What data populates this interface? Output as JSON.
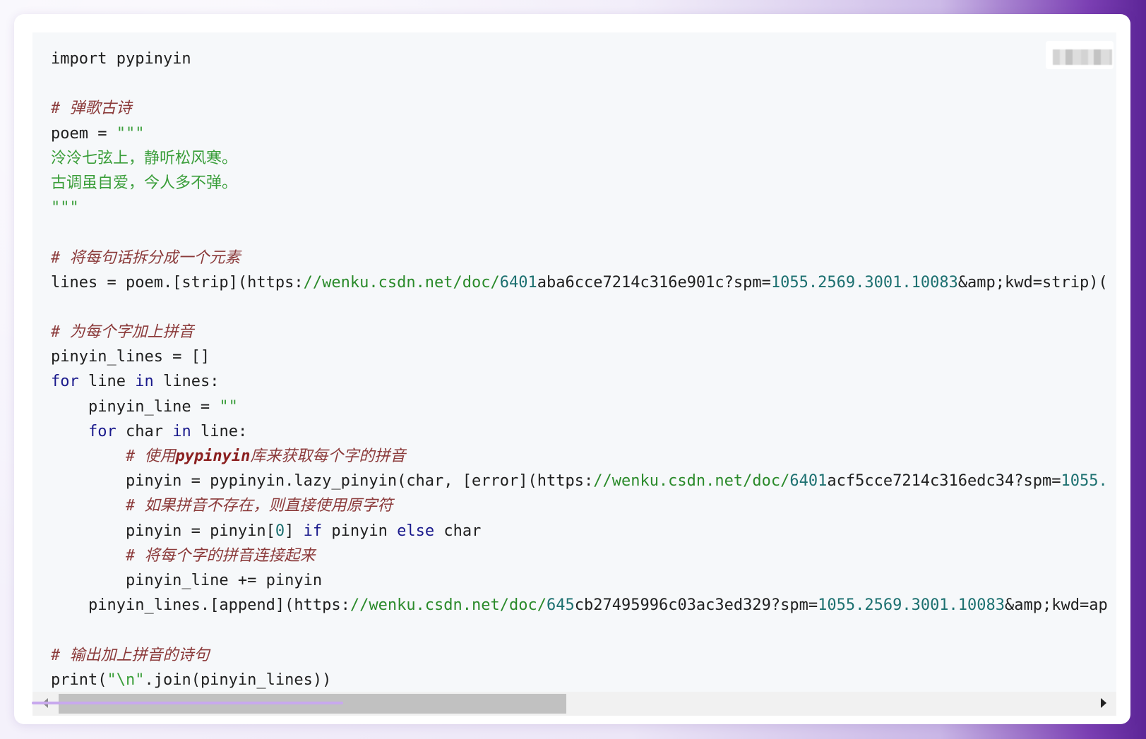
{
  "code": {
    "lines": [
      [
        {
          "t": "import pypinyin",
          "c": ""
        }
      ],
      [],
      [
        {
          "t": "# 弹歌古诗",
          "c": "cmt"
        }
      ],
      [
        {
          "t": "poem = ",
          "c": ""
        },
        {
          "t": "\"\"\"",
          "c": "str"
        }
      ],
      [
        {
          "t": "泠泠七弦上，静听松风寒。",
          "c": "str-cjk"
        }
      ],
      [
        {
          "t": "古调虽自爱，今人多不弹。",
          "c": "str-cjk"
        }
      ],
      [
        {
          "t": "\"\"\"",
          "c": "str"
        }
      ],
      [],
      [
        {
          "t": "# 将每句话拆分成一个元素",
          "c": "cmt"
        }
      ],
      [
        {
          "t": "lines = poem.[strip](https:",
          "c": ""
        },
        {
          "t": "//wenku.csdn.net",
          "c": "path"
        },
        {
          "t": "/doc/",
          "c": "path"
        },
        {
          "t": "6401",
          "c": "num"
        },
        {
          "t": "aba6cce7214c316e901c?spm=",
          "c": ""
        },
        {
          "t": "1055.2569.3001.10083",
          "c": "num"
        },
        {
          "t": "&amp;kwd=strip)(",
          "c": ""
        }
      ],
      [],
      [
        {
          "t": "# 为每个字加上拼音",
          "c": "cmt"
        }
      ],
      [
        {
          "t": "pinyin_lines = []",
          "c": ""
        }
      ],
      [
        {
          "t": "for",
          "c": "kw"
        },
        {
          "t": " line ",
          "c": ""
        },
        {
          "t": "in",
          "c": "kw"
        },
        {
          "t": " lines:",
          "c": ""
        }
      ],
      [
        {
          "t": "    pinyin_line = ",
          "c": ""
        },
        {
          "t": "\"\"",
          "c": "str"
        }
      ],
      [
        {
          "t": "    ",
          "c": ""
        },
        {
          "t": "for",
          "c": "kw"
        },
        {
          "t": " char ",
          "c": ""
        },
        {
          "t": "in",
          "c": "kw"
        },
        {
          "t": " line:",
          "c": ""
        }
      ],
      [
        {
          "t": "        # 使用",
          "c": "cmt"
        },
        {
          "t": "pypinyin",
          "c": "cmt-em"
        },
        {
          "t": "库来获取每个字的拼音",
          "c": "cmt"
        }
      ],
      [
        {
          "t": "        pinyin = pypinyin.lazy_pinyin(char, [error](https:",
          "c": ""
        },
        {
          "t": "//wenku.csdn.net",
          "c": "path"
        },
        {
          "t": "/doc/",
          "c": "path"
        },
        {
          "t": "6401",
          "c": "num"
        },
        {
          "t": "acf5cce7214c316edc34?spm=",
          "c": ""
        },
        {
          "t": "1055.",
          "c": "num"
        }
      ],
      [
        {
          "t": "        # 如果拼音不存在，则直接使用原字符",
          "c": "cmt"
        }
      ],
      [
        {
          "t": "        pinyin = pinyin[",
          "c": ""
        },
        {
          "t": "0",
          "c": "num"
        },
        {
          "t": "] ",
          "c": ""
        },
        {
          "t": "if",
          "c": "kw"
        },
        {
          "t": " pinyin ",
          "c": ""
        },
        {
          "t": "else",
          "c": "kw"
        },
        {
          "t": " char",
          "c": ""
        }
      ],
      [
        {
          "t": "        # 将每个字的拼音连接起来",
          "c": "cmt"
        }
      ],
      [
        {
          "t": "        pinyin_line += pinyin",
          "c": ""
        }
      ],
      [
        {
          "t": "    pinyin_lines.[append](https:",
          "c": ""
        },
        {
          "t": "//wenku.csdn.net",
          "c": "path"
        },
        {
          "t": "/doc/",
          "c": "path"
        },
        {
          "t": "645",
          "c": "num"
        },
        {
          "t": "cb27495996c03ac3ed329?spm=",
          "c": ""
        },
        {
          "t": "1055.2569.3001.10083",
          "c": "num"
        },
        {
          "t": "&amp;kwd=ap",
          "c": ""
        }
      ],
      [],
      [
        {
          "t": "# 输出加上拼音的诗句",
          "c": "cmt"
        }
      ],
      [
        {
          "t": "print(",
          "c": ""
        },
        {
          "t": "\"\\n\"",
          "c": "str"
        },
        {
          "t": ".join(pinyin_lines))",
          "c": ""
        }
      ]
    ]
  },
  "scrollbar": {
    "left_icon": "scroll-left-arrow-icon",
    "right_icon": "scroll-right-arrow-icon",
    "position_fraction": 0.0
  },
  "colors": {
    "keyword": "#1a1a8c",
    "string": "#3a9e3a",
    "number": "#1c7070",
    "comment": "#8b3a3a",
    "accent": "#7b3fb3"
  }
}
